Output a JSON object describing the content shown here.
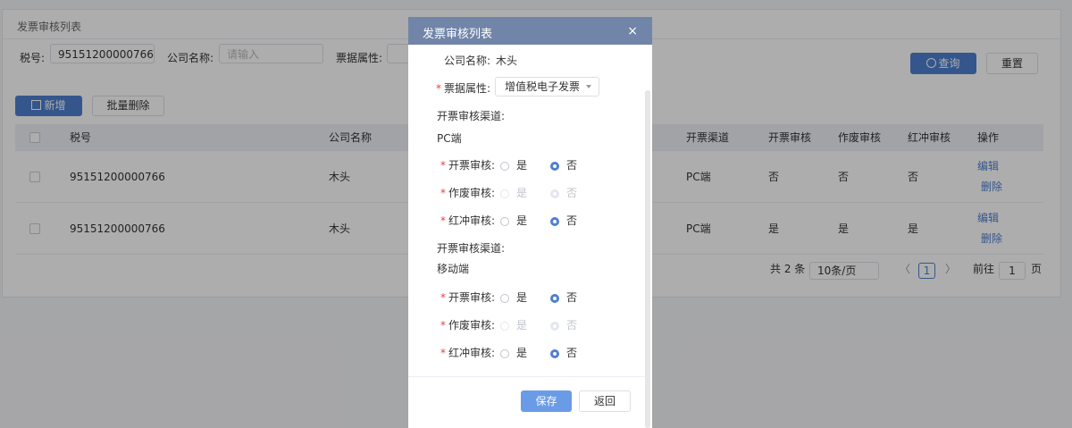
{
  "page": {
    "title": "发票审核列表",
    "filters": {
      "tax_label": "税号:",
      "tax_value": "95151200000766",
      "company_label": "公司名称:",
      "company_placeholder": "请输入",
      "attr_label": "票据属性:"
    },
    "query_label": "查询",
    "reset_label": "重置",
    "add_label": "新增",
    "batch_delete_label": "批量删除",
    "table": {
      "headers": [
        "税号",
        "公司名称",
        "开票渠道",
        "开票审核",
        "作废审核",
        "红冲审核",
        "操作"
      ],
      "rows": [
        {
          "tax": "95151200000766",
          "company": "木头",
          "channel": "PC端",
          "issue": "否",
          "void": "否",
          "red": "否"
        },
        {
          "tax": "95151200000766",
          "company": "木头",
          "channel": "PC端",
          "issue": "是",
          "void": "是",
          "red": "是"
        }
      ],
      "edit_label": "编辑",
      "delete_label": "删除"
    },
    "pager": {
      "total": "共 2 条",
      "page_size": "10条/页",
      "current": "1",
      "goto_label": "前往",
      "goto_value": "1",
      "page_suffix": "页"
    }
  },
  "modal": {
    "title": "发票审核列表",
    "company_label": "公司名称:",
    "company_value": "木头",
    "attr_label": "票据属性:",
    "attr_value": "增值税电子发票",
    "channel_label": "开票审核渠道:",
    "pc_label": "PC端",
    "mobile_label": "移动端",
    "issue_label": "开票审核:",
    "void_label": "作废审核:",
    "red_label": "红冲审核:",
    "yes": "是",
    "no": "否",
    "save_label": "保存",
    "back_label": "返回"
  },
  "colors": {
    "primary": "#4f7fce",
    "modal_header": "#7185a8",
    "required": "#e64242"
  }
}
